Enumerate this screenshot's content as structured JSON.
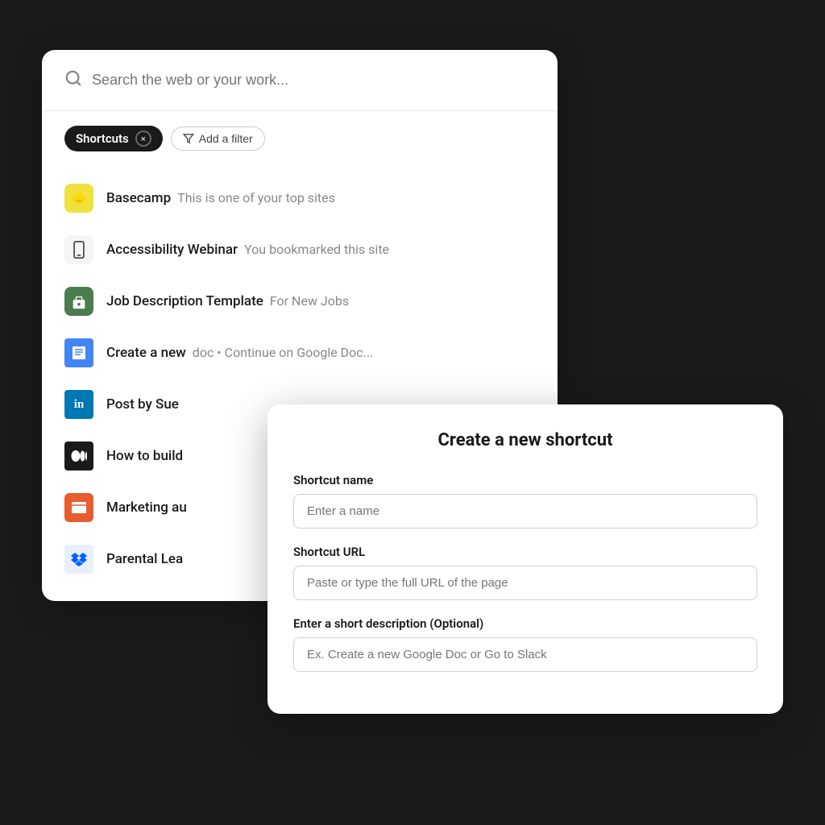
{
  "search": {
    "placeholder": "Search the web or your work...",
    "icon": "🔍"
  },
  "filter": {
    "badge_label": "Shortcuts",
    "badge_close_label": "×",
    "add_filter_label": "Add a filter",
    "filter_icon": "⊽"
  },
  "results": [
    {
      "id": "basecamp",
      "title": "Basecamp",
      "subtitle": "This is one of your top sites",
      "icon_type": "basecamp",
      "icon_text": "⚡"
    },
    {
      "id": "accessibility-webinar",
      "title": "Accessibility Webinar",
      "subtitle": "You bookmarked this site",
      "icon_type": "phone",
      "icon_text": "📱"
    },
    {
      "id": "job-description",
      "title": "Job Description Template",
      "subtitle": "For New Jobs",
      "icon_type": "job",
      "icon_text": "🪑"
    },
    {
      "id": "create-new",
      "title": "Create a new",
      "subtitle": "doc • Continue on Google Doc...",
      "icon_type": "gdoc",
      "icon_text": "≡"
    },
    {
      "id": "post-by-sue",
      "title": "Post by Sue",
      "subtitle": "",
      "icon_type": "linkedin",
      "icon_text": "in"
    },
    {
      "id": "how-to-build",
      "title": "How to build",
      "subtitle": "",
      "icon_type": "medium",
      "icon_text": "▪▪"
    },
    {
      "id": "marketing-au",
      "title": "Marketing au",
      "subtitle": "",
      "icon_type": "orange",
      "icon_text": "◼"
    },
    {
      "id": "parental-lea",
      "title": "Parental Lea",
      "subtitle": "",
      "icon_type": "dropbox",
      "icon_text": "❖"
    }
  ],
  "modal": {
    "title": "Create a new shortcut",
    "name_label": "Shortcut name",
    "name_placeholder": "Enter a name",
    "url_label": "Shortcut URL",
    "url_placeholder": "Paste or type the full URL of the page",
    "desc_label": "Enter a short description (Optional)",
    "desc_placeholder": "Ex. Create a new Google Doc or Go to Slack"
  }
}
